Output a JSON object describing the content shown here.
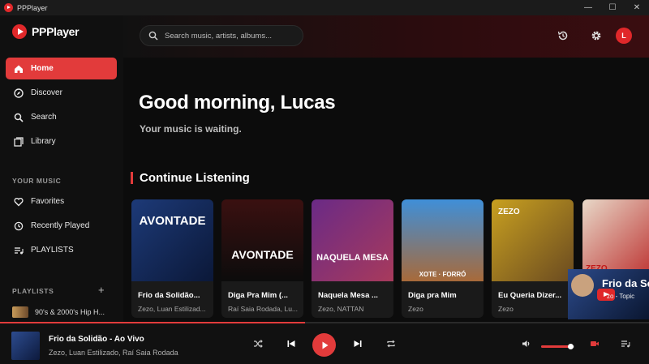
{
  "window": {
    "title": "PPPlayer",
    "controls": [
      "—",
      "☐",
      "✕"
    ]
  },
  "brand": {
    "name": "PPPlayer",
    "accent": "#e23b3b"
  },
  "search": {
    "placeholder": "Search music, artists, albums..."
  },
  "user": {
    "initial": "L"
  },
  "nav": {
    "items": [
      {
        "label": "Home",
        "icon": "home-icon",
        "active": true
      },
      {
        "label": "Discover",
        "icon": "compass-icon"
      },
      {
        "label": "Search",
        "icon": "search-icon"
      },
      {
        "label": "Library",
        "icon": "library-icon"
      }
    ],
    "your_music_label": "YOUR MUSIC",
    "your_music": [
      {
        "label": "Favorites",
        "icon": "heart-icon"
      },
      {
        "label": "Recently Played",
        "icon": "history-icon"
      },
      {
        "label": "PLAYLISTS",
        "icon": "playlist-icon"
      }
    ],
    "playlists_label": "PLAYLISTS",
    "add_playlist": "+",
    "playlists": [
      {
        "label": "90's & 2000's Hip H..."
      }
    ]
  },
  "main": {
    "greeting": "Good morning, Lucas",
    "subtitle": "Your music is waiting.",
    "section_title": "Continue Listening",
    "cards": [
      {
        "title": "Frio da Solidão...",
        "artist": "Zezo, Luan Estilizad...",
        "art_text": "AVONTADE",
        "art_colors": [
          "#1d3a78",
          "#0b1838"
        ]
      },
      {
        "title": "Diga Pra Mim (...",
        "artist": "Raí Saia Rodada, Lu...",
        "art_text": "AVONTADE",
        "art_colors": [
          "#3a1010",
          "#0c0c0c"
        ]
      },
      {
        "title": "Naquela Mesa ...",
        "artist": "Zezo, NATTAN",
        "art_text": "NAQUELA MESA",
        "art_colors": [
          "#6a2a86",
          "#a83a5c"
        ]
      },
      {
        "title": "Diga pra Mim",
        "artist": "Zezo",
        "art_text": "XOTE · FORRÓ",
        "art_colors": [
          "#3f8fd8",
          "#a86a3a"
        ]
      },
      {
        "title": "Eu Queria Dizer...",
        "artist": "Zezo",
        "art_text": "ZEZO",
        "art_colors": [
          "#c8a020",
          "#6a4a20"
        ]
      },
      {
        "title": "",
        "artist": "",
        "art_text": "ZEZO",
        "art_colors": [
          "#e8d8c8",
          "#b82020"
        ]
      }
    ],
    "mini_video": {
      "title": "Frio da Sol",
      "subtitle": "zo - Topic"
    }
  },
  "player": {
    "title": "Frio da Solidão - Ao Vivo",
    "artist": "Zezo, Luan Estilizado, Raí Saia Rodada",
    "progress": 0.47,
    "volume": 0.9
  }
}
